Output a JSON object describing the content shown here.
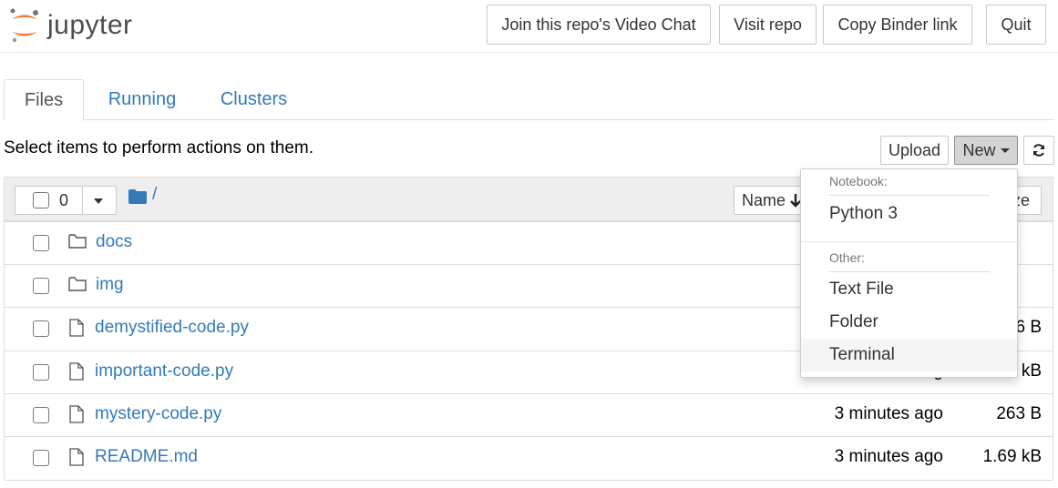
{
  "header": {
    "logo_text": "jupyter",
    "buttons": {
      "video_chat": "Join this repo's Video Chat",
      "visit_repo": "Visit repo",
      "copy_binder": "Copy Binder link",
      "quit": "Quit"
    }
  },
  "tabs": [
    {
      "label": "Files",
      "active": true
    },
    {
      "label": "Running",
      "active": false
    },
    {
      "label": "Clusters",
      "active": false
    }
  ],
  "toolbar": {
    "hint": "Select items to perform actions on them.",
    "upload_label": "Upload",
    "new_label": "New",
    "refresh_icon": "refresh-icon"
  },
  "list_header": {
    "selected_count": "0",
    "breadcrumb": "/",
    "sort_name_label": "Name",
    "sort_size_label": "ze"
  },
  "files": [
    {
      "name": "docs",
      "type": "folder",
      "modified": "",
      "size": ""
    },
    {
      "name": "img",
      "type": "folder",
      "modified": "",
      "size": ""
    },
    {
      "name": "demystified-code.py",
      "type": "file",
      "modified": "",
      "size": "6 B"
    },
    {
      "name": "important-code.py",
      "type": "file",
      "modified": "g",
      "size": "kB"
    },
    {
      "name": "mystery-code.py",
      "type": "file",
      "modified": "3 minutes ago",
      "size": "263 B"
    },
    {
      "name": "README.md",
      "type": "file",
      "modified": "3 minutes ago",
      "size": "1.69 kB"
    }
  ],
  "new_menu": {
    "notebook_header": "Notebook:",
    "python3": "Python 3",
    "other_header": "Other:",
    "text_file": "Text File",
    "folder": "Folder",
    "terminal": "Terminal"
  },
  "colors": {
    "link": "#337ab7",
    "jupyter_orange": "#F37726",
    "logo_text": "#4e4e4e"
  }
}
